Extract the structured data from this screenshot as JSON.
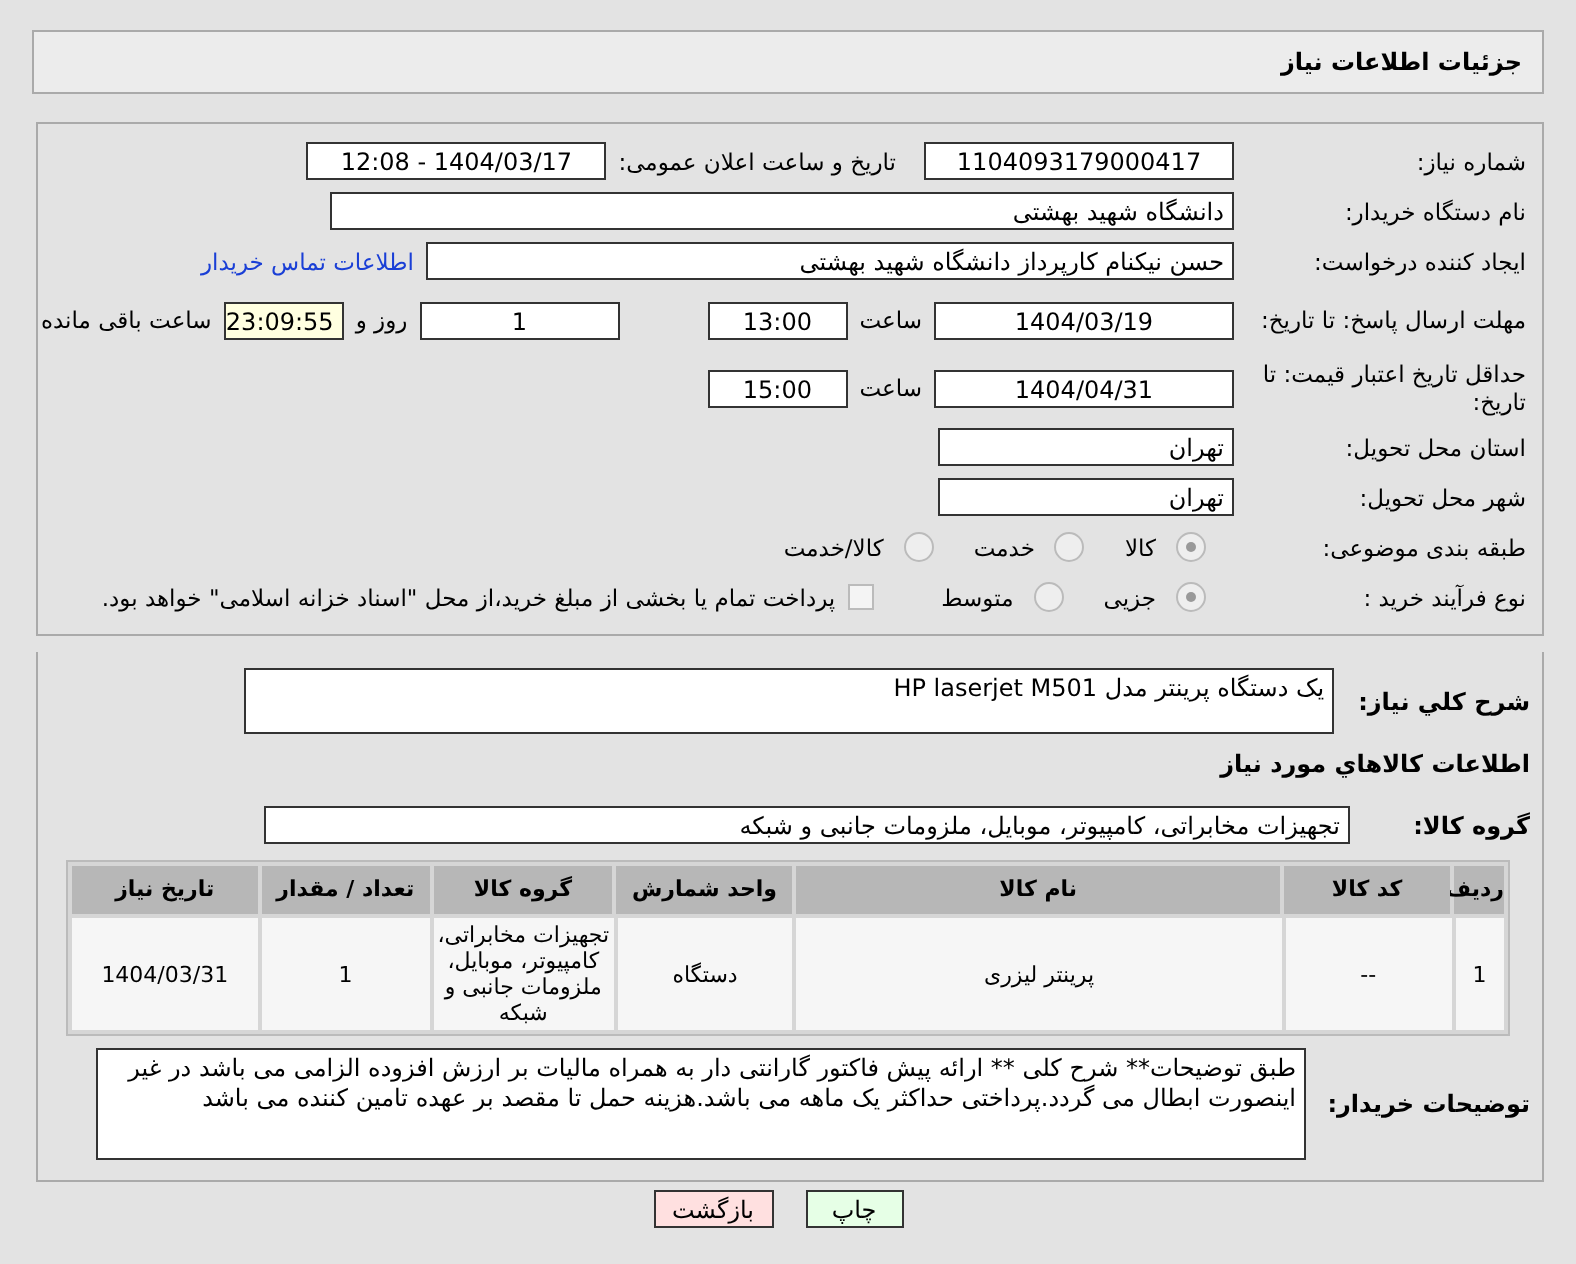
{
  "header": {
    "title": "جزئیات اطلاعات نیاز"
  },
  "need_number": {
    "label": "شماره نیاز:",
    "value": "1104093179000417"
  },
  "announce": {
    "label": "تاریخ و ساعت اعلان عمومی:",
    "value": "1404/03/17 - 12:08"
  },
  "buyer_org": {
    "label": "نام دستگاه خریدار:",
    "value": "دانشگاه شهید بهشتی"
  },
  "requester": {
    "label": "ایجاد کننده درخواست:",
    "value": "حسن نیکنام کارپرداز دانشگاه شهید بهشتی",
    "link": "اطلاعات تماس خریدار"
  },
  "reply_deadline": {
    "label": "مهلت ارسال پاسخ: تا تاریخ:",
    "date": "1404/03/19",
    "time_label": "ساعت",
    "time": "13:00",
    "days": "1",
    "days_label": "روز و",
    "remaining": "23:09:55",
    "remaining_label": "ساعت باقی مانده"
  },
  "price_validity": {
    "label": "حداقل تاریخ اعتبار قیمت: تا تاریخ:",
    "date": "1404/04/31",
    "time_label": "ساعت",
    "time": "15:00"
  },
  "province": {
    "label": "استان محل تحویل:",
    "value": "تهران"
  },
  "city": {
    "label": "شهر محل تحویل:",
    "value": "تهران"
  },
  "category": {
    "label": "طبقه بندی موضوعی:",
    "options": [
      {
        "label": "کالا",
        "selected": true
      },
      {
        "label": "خدمت",
        "selected": false
      },
      {
        "label": "کالا/خدمت",
        "selected": false
      }
    ]
  },
  "purchase_type": {
    "label": "نوع فرآیند خرید :",
    "options": [
      {
        "label": "جزیی",
        "selected": true
      },
      {
        "label": "متوسط",
        "selected": false
      }
    ],
    "payment": {
      "label": "پرداخت تمام یا بخشی از مبلغ خرید،از محل \"اسناد خزانه اسلامی\" خواهد بود.",
      "checked": false
    }
  },
  "description": {
    "label": "شرح کلي نياز:",
    "value": "یک دستگاه پرینتر مدل  HP laserjet M501"
  },
  "goods_title": "اطلاعات کالاهاي مورد نياز",
  "goods_group": {
    "label": "گروه کالا:",
    "value": "تجهیزات مخابراتی، کامپیوتر، موبایل، ملزومات جانبی و شبکه"
  },
  "table": {
    "columns": [
      "ردیف",
      "کد کالا",
      "نام کالا",
      "واحد شمارش",
      "گروه کالا",
      "تعداد / مقدار",
      "تاریخ نیاز"
    ],
    "rows": [
      [
        "1",
        "--",
        "پرینتر لیزری",
        "دستگاه",
        "تجهیزات مخابراتی، کامپیوتر، موبایل، ملزومات جانبی و شبکه",
        "1",
        "1404/03/31"
      ]
    ]
  },
  "buyer_notes": {
    "label": "توضیحات خریدار:",
    "value": "طبق توضیحات** شرح کلی  ** ارائه پیش فاکتور  گارانتی دار به همراه مالیات بر ارزش افزوده الزامی می باشد در غیر اینصورت ابطال می گردد.پرداختی حداکثر یک ماهه می باشد.هزینه حمل تا مقصد بر عهده تامین کننده می باشد"
  },
  "buttons": [
    {
      "label": "چاپ",
      "kind": "print"
    },
    {
      "label": "بازگشت",
      "kind": "back"
    }
  ]
}
